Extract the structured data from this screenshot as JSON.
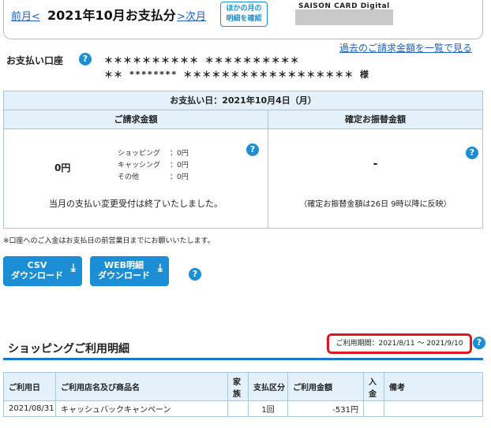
{
  "header": {
    "prev_label": "前月<",
    "month_label": "2021年10月お支払分",
    "next_label": ">次月",
    "other_month_line1": "ほかの月の",
    "other_month_line2": "明細を確認",
    "brand_label": "SAISON CARD Digital"
  },
  "history_link": "過去のご請求金額を一覧で見る",
  "account": {
    "label": "お支払い口座",
    "line1": "＊＊＊＊＊＊＊＊＊＊ ＊＊＊＊＊＊＊＊＊＊",
    "line2": "＊＊ ******** ＊＊＊＊＊＊＊＊＊＊＊＊＊＊＊＊＊＊ 様"
  },
  "payment": {
    "due_date": "お支払い日：2021年10月4日（月）",
    "billing_header": "ご請求金額",
    "confirmed_header": "確定お振替金額",
    "billing_amount": "0円",
    "breakdown": [
      {
        "label": "ショッピング",
        "value": "：0円"
      },
      {
        "label": "キャッシング",
        "value": "：0円"
      },
      {
        "label": "その他",
        "value": "：0円"
      }
    ],
    "billing_note": "当月の支払い変更受付は終了いたしました。",
    "confirmed_amount": "-",
    "confirmed_note": "（確定お振替金額は26日 9時以降に反映）"
  },
  "footnote": "※口座へのご入金はお支払日の前営業日までにお願いいたします。",
  "downloads": {
    "csv_line1": "CSV",
    "csv_line2": "ダウンロード",
    "web_line1": "WEB明細",
    "web_line2": "ダウンロード"
  },
  "shopping": {
    "title": "ショッピングご利用明細",
    "period": "ご利用期間：2021/8/11 ～ 2021/9/10",
    "columns": [
      "ご利用日",
      "ご利用店名及び商品名",
      "家族",
      "支払区分",
      "ご利用金額",
      "入金",
      "備考"
    ],
    "rows": [
      {
        "date": "2021/08/31",
        "store": "キャッシュバックキャンペーン",
        "family": "",
        "type": "1回",
        "amount": "-531円",
        "deposit": "",
        "note": ""
      }
    ]
  },
  "help_icon": "?",
  "colors": {
    "accent": "#1b8ed6",
    "highlight": "#e0161e",
    "header_bg": "#e4f0fa"
  },
  "icons": {
    "help": "question-circle-icon",
    "download": "download-arrow-icon"
  }
}
